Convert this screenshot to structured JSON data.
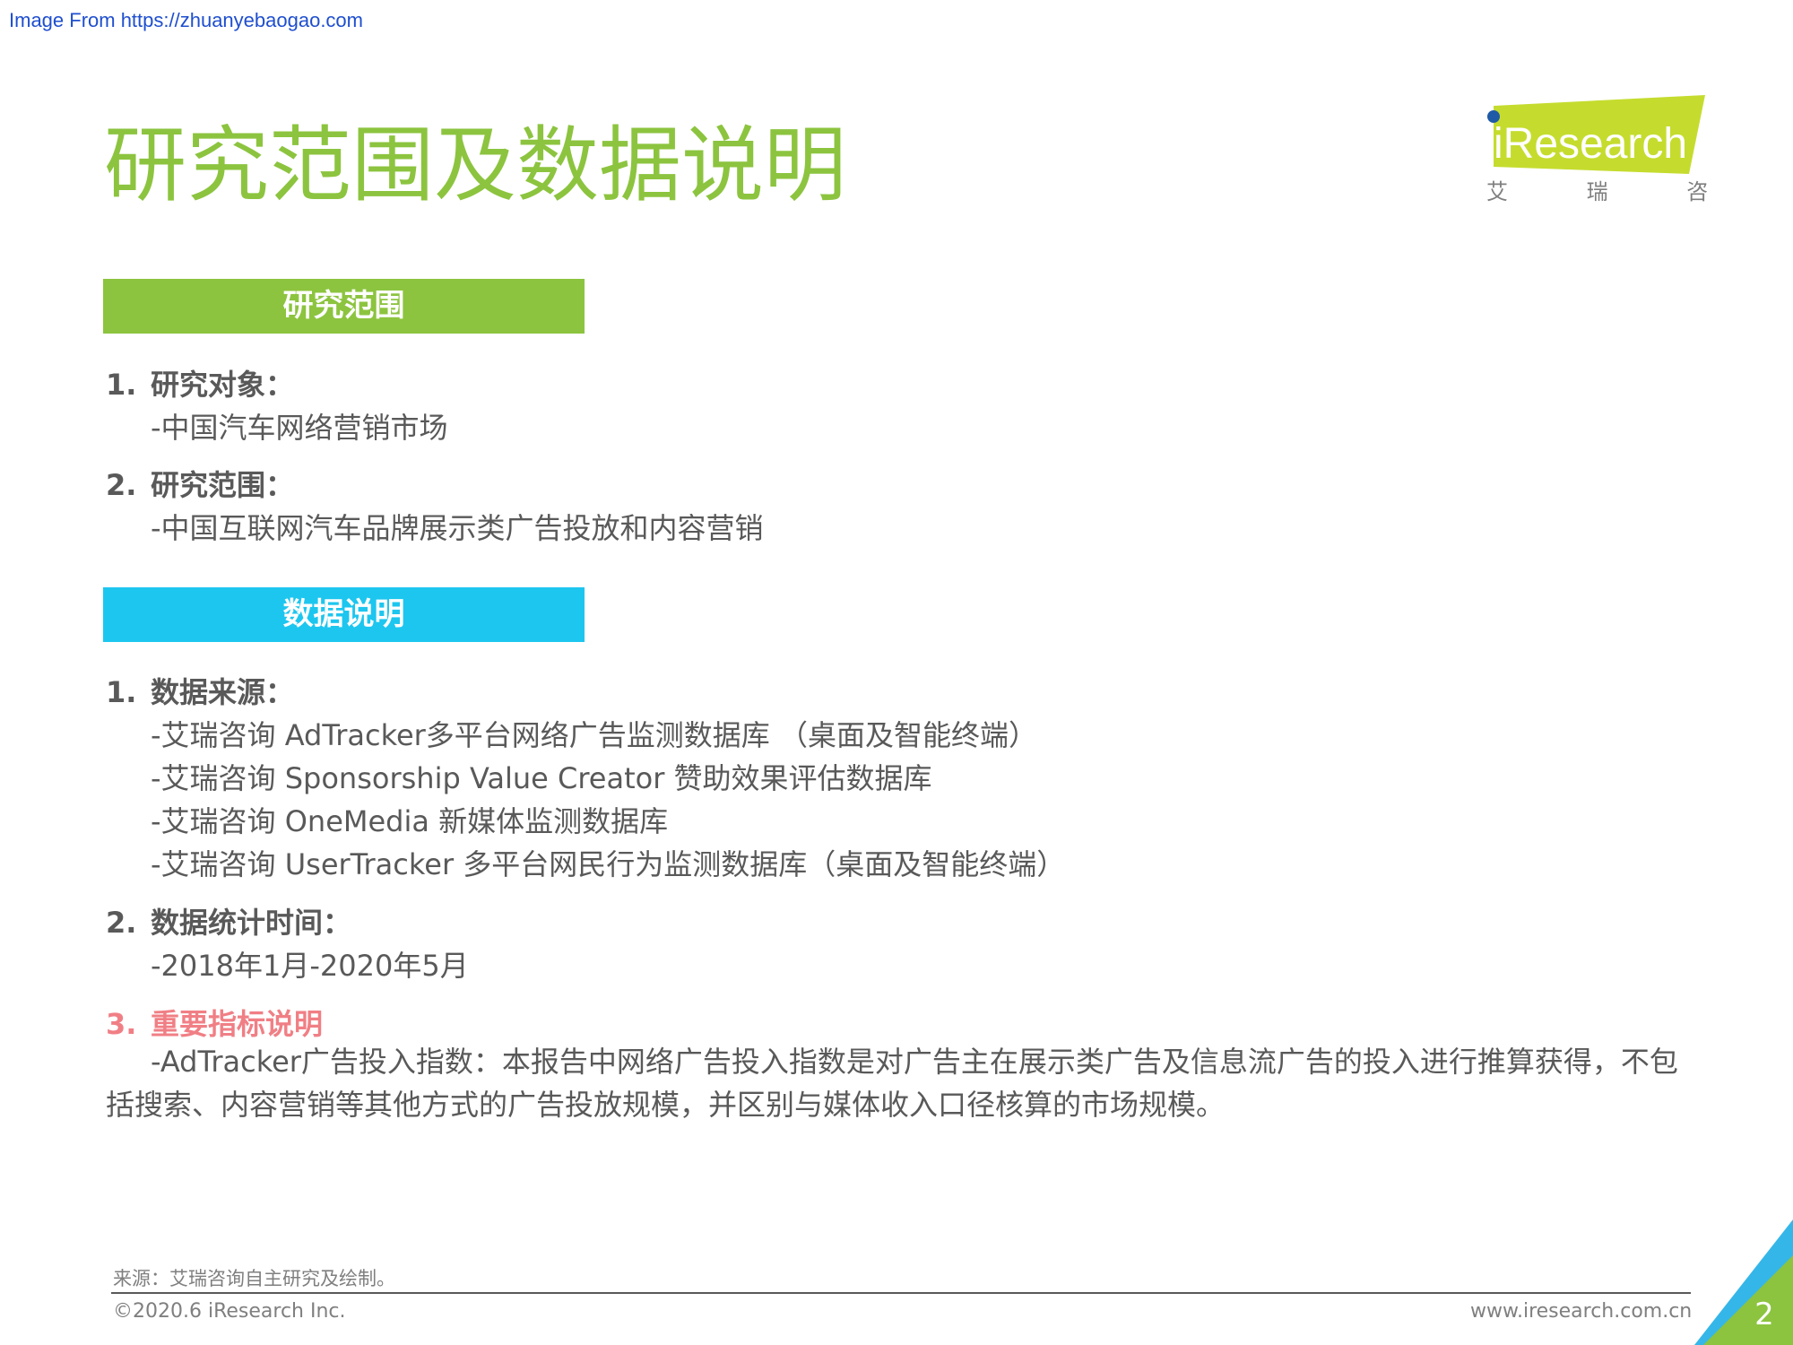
{
  "watermark": "Image From https://zhuanyebaogao.com",
  "title": "研究范围及数据说明",
  "logo": {
    "brand": "iResearch",
    "chinese": "艾 瑞 咨 询",
    "colors": {
      "green": "#c5dc2e",
      "blue": "#1f5aa6"
    }
  },
  "scope": {
    "header": "研究范围",
    "items": [
      {
        "num": "1.",
        "title": "研究对象：",
        "lines": [
          "-中国汽车网络营销市场"
        ]
      },
      {
        "num": "2.",
        "title": "研究范围：",
        "lines": [
          "-中国互联网汽车品牌展示类广告投放和内容营销"
        ]
      }
    ]
  },
  "data_notes": {
    "header": "数据说明",
    "items": [
      {
        "num": "1.",
        "title": "数据来源：",
        "lines": [
          "-艾瑞咨询 AdTracker多平台网络广告监测数据库 （桌面及智能终端）",
          "-艾瑞咨询 Sponsorship Value Creator 赞助效果评估数据库",
          "-艾瑞咨询 OneMedia 新媒体监测数据库",
          "-艾瑞咨询 UserTracker 多平台网民行为监测数据库（桌面及智能终端）"
        ]
      },
      {
        "num": "2.",
        "title": "数据统计时间：",
        "lines": [
          "-2018年1月-2020年5月"
        ]
      },
      {
        "num": "3.",
        "title": "重要指标说明",
        "paragraph": "-AdTracker广告投入指数：本报告中网络广告投入指数是对广告主在展示类广告及信息流广告的投入进行推算获得，不包括搜索、内容营销等其他方式的广告投放规模，并区别与媒体收入口径核算的市场规模。"
      }
    ]
  },
  "footer": {
    "source": "来源：艾瑞咨询自主研究及绘制。",
    "copyright": "©2020.6 iResearch Inc.",
    "website": "www.iresearch.com.cn",
    "page": "2"
  },
  "colors": {
    "title_green": "#8cc43f",
    "header_blue": "#1dc6ef",
    "highlight_red": "#f07f85",
    "text_gray": "#595959"
  }
}
